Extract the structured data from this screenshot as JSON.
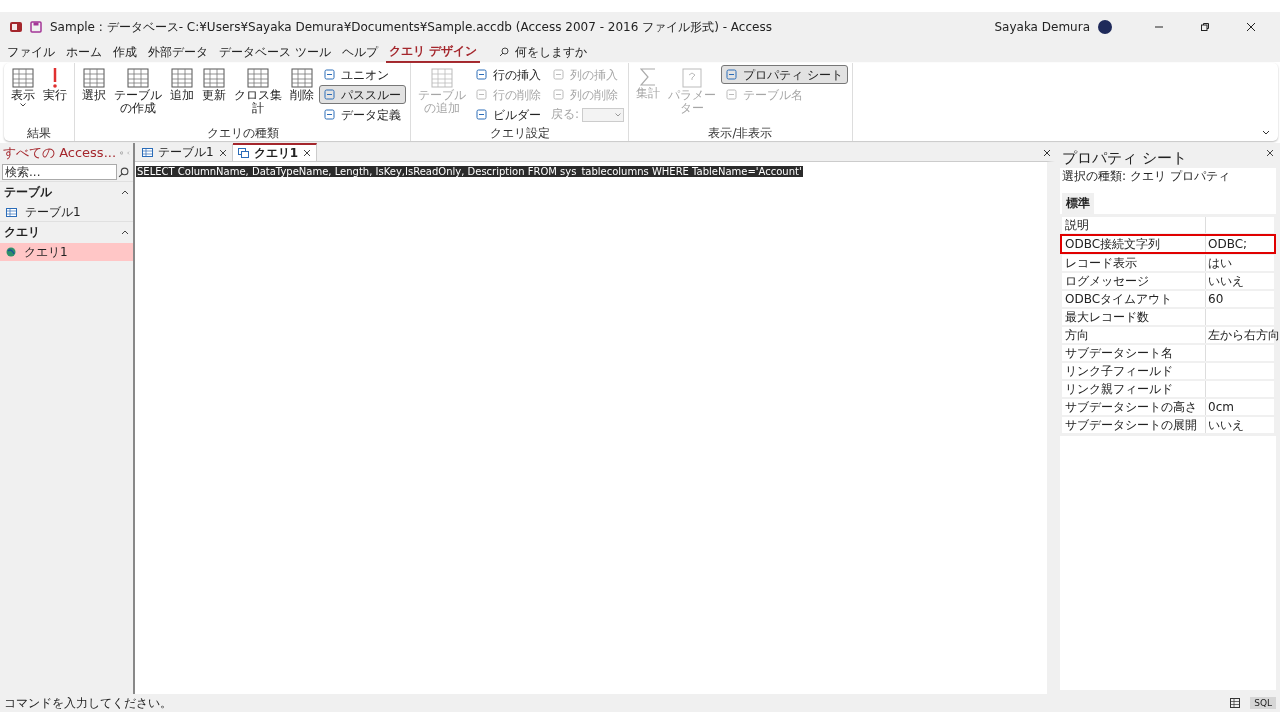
{
  "window": {
    "title": "Sample : データベース- C:¥Users¥Sayaka Demura¥Documents¥Sample.accdb (Access 2007 - 2016 ファイル形式)  -  Access",
    "user": "Sayaka Demura"
  },
  "menu_tabs": [
    {
      "label": "ファイル",
      "selected": false
    },
    {
      "label": "ホーム",
      "selected": false
    },
    {
      "label": "作成",
      "selected": false
    },
    {
      "label": "外部データ",
      "selected": false
    },
    {
      "label": "データベース ツール",
      "selected": false
    },
    {
      "label": "ヘルプ",
      "selected": false
    },
    {
      "label": "クエリ デザイン",
      "selected": true
    }
  ],
  "tell_me": {
    "placeholder": "何をしますか"
  },
  "ribbon_groups": [
    {
      "label": "結果",
      "buttons": [
        {
          "kind": "large",
          "label": "表示",
          "dropdown": true,
          "disabled": false
        },
        {
          "kind": "large",
          "label": "実行",
          "dropdown": false,
          "disabled": false
        }
      ]
    },
    {
      "label": "クエリの種類",
      "buttons": [
        {
          "kind": "large",
          "label": "選択",
          "disabled": false
        },
        {
          "kind": "large",
          "label": "テーブルの作成",
          "disabled": false
        },
        {
          "kind": "large",
          "label": "追加",
          "disabled": false
        },
        {
          "kind": "large",
          "label": "更新",
          "disabled": false
        },
        {
          "kind": "large",
          "label": "クロス集計",
          "disabled": false
        },
        {
          "kind": "large",
          "label": "削除",
          "disabled": false
        },
        {
          "kind": "small",
          "label": "ユニオン",
          "disabled": false,
          "selected": false
        },
        {
          "kind": "small",
          "label": "パススルー",
          "disabled": false,
          "selected": true
        },
        {
          "kind": "small",
          "label": "データ定義",
          "disabled": false,
          "selected": false
        }
      ]
    },
    {
      "label": "クエリ設定",
      "buttons": [
        {
          "kind": "large",
          "label": "テーブルの追加",
          "disabled": true
        },
        {
          "kind": "small",
          "label": "行の挿入",
          "disabled": false,
          "selected": false
        },
        {
          "kind": "small",
          "label": "行の削除",
          "disabled": true,
          "selected": false
        },
        {
          "kind": "small",
          "label": "ビルダー",
          "disabled": false,
          "selected": false
        },
        {
          "kind": "small",
          "label": "列の挿入",
          "disabled": true,
          "selected": false
        },
        {
          "kind": "small",
          "label": "列の削除",
          "disabled": true,
          "selected": false
        },
        {
          "kind": "combo",
          "label": "戻る:",
          "disabled": true
        }
      ]
    },
    {
      "label": "表示/非表示",
      "buttons": [
        {
          "kind": "large",
          "label": "集計",
          "disabled": true
        },
        {
          "kind": "large",
          "label": "パラメーター",
          "disabled": true
        },
        {
          "kind": "small",
          "label": "プロパティ シート",
          "disabled": false,
          "selected": true
        },
        {
          "kind": "small",
          "label": "テーブル名",
          "disabled": true,
          "selected": false
        }
      ]
    }
  ],
  "nav_pane": {
    "title": "すべての Access...",
    "search": {
      "placeholder": "検索..."
    },
    "groups": [
      {
        "label": "テーブル",
        "expanded": true,
        "items": [
          {
            "label": "テーブル1",
            "kind": "table",
            "selected": false
          }
        ]
      },
      {
        "label": "クエリ",
        "expanded": true,
        "items": [
          {
            "label": "クエリ1",
            "kind": "query",
            "selected": true
          }
        ]
      }
    ]
  },
  "doc_tabs": [
    {
      "label": "テーブル1",
      "kind": "table",
      "selected": false
    },
    {
      "label": "クエリ1",
      "kind": "query",
      "selected": true
    }
  ],
  "sql_text": "SELECT ColumnName, DataTypeName, Length, IsKey,IsReadOnly, Description FROM sys_tablecolumns WHERE TableName='Account'",
  "property_sheet": {
    "title": "プロパティ シート",
    "selection_type": "選択の種類:  クエリ プロパティ",
    "tabs": [
      {
        "label": "標準",
        "selected": true
      }
    ],
    "rows": [
      {
        "label": "説明",
        "value": "",
        "highlighted": false
      },
      {
        "label": "ODBC接続文字列",
        "value": "ODBC;",
        "highlighted": true
      },
      {
        "label": "レコード表示",
        "value": "はい",
        "highlighted": false
      },
      {
        "label": "ログメッセージ",
        "value": "いいえ",
        "highlighted": false
      },
      {
        "label": "ODBCタイムアウト",
        "value": "60",
        "highlighted": false
      },
      {
        "label": "最大レコード数",
        "value": "",
        "highlighted": false
      },
      {
        "label": "方向",
        "value": "左から右方向",
        "highlighted": false
      },
      {
        "label": "サブデータシート名",
        "value": "",
        "highlighted": false
      },
      {
        "label": "リンク子フィールド",
        "value": "",
        "highlighted": false
      },
      {
        "label": "リンク親フィールド",
        "value": "",
        "highlighted": false
      },
      {
        "label": "サブデータシートの高さ",
        "value": "0cm",
        "highlighted": false
      },
      {
        "label": "サブデータシートの展開",
        "value": "いいえ",
        "highlighted": false
      }
    ]
  },
  "status_bar": {
    "text": "コマンドを入力してください。",
    "views": [
      {
        "kind": "datasheet",
        "selected": false
      },
      {
        "kind": "sql",
        "label": "SQL",
        "selected": true
      }
    ]
  }
}
